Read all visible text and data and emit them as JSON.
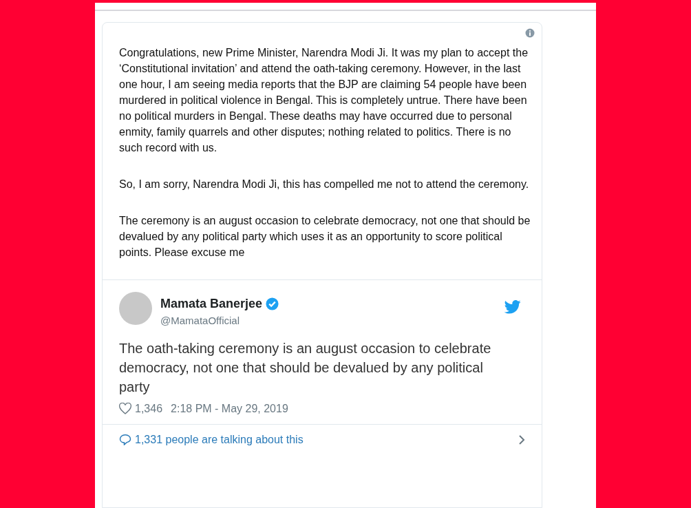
{
  "statement": {
    "paragraphs": [
      "Congratulations, new Prime Minister, Narendra Modi Ji. It was my plan to accept the ‘Constitutional invitation’ and attend the oath-taking ceremony. However, in the last one hour, I am seeing media reports that the BJP are claiming 54 people have been murdered in political violence in Bengal. This is completely untrue. There have been no political murders in Bengal. These deaths may have occurred due to personal enmity, family quarrels and other disputes; nothing related to politics. There is no such record with us.",
      "So, I am sorry, Narendra Modi Ji, this has compelled me not to attend the ceremony.",
      "The ceremony is an august occasion to celebrate democracy, not one that should be devalued by any political party which uses it as an opportunity to score political points. Please excuse me"
    ]
  },
  "tweet": {
    "name": "Mamata Banerjee",
    "verified": true,
    "handle": "@MamataOfficial",
    "text": "The oath-taking ceremony is an august occasion to celebrate democracy, not one that should be devalued by any political party",
    "likes": "1,346",
    "time": "2:18 PM - May 29, 2019",
    "talking": "1,331 people are talking about this"
  }
}
